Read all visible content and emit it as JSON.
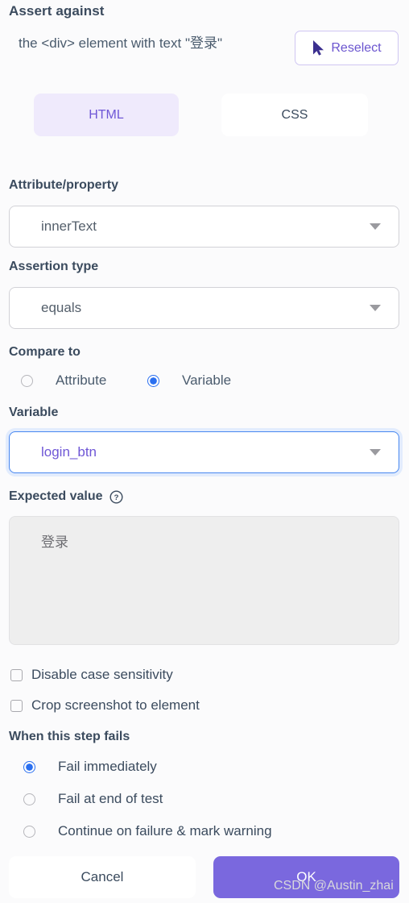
{
  "header": {
    "title": "Assert against",
    "description": "the <div> element with text \"登录\"",
    "reselect_label": "Reselect",
    "cursor_icon": "cursor-arrow-icon"
  },
  "tabs": [
    {
      "label": "HTML",
      "active": true
    },
    {
      "label": "CSS",
      "active": false
    }
  ],
  "fields": {
    "attribute": {
      "label": "Attribute/property",
      "value": "innerText",
      "chevron_icon": "chevron-down-icon"
    },
    "assertion_type": {
      "label": "Assertion type",
      "value": "equals",
      "chevron_icon": "chevron-down-icon"
    },
    "compare_to": {
      "label": "Compare to",
      "options": [
        {
          "label": "Attribute",
          "selected": false
        },
        {
          "label": "Variable",
          "selected": true
        }
      ]
    },
    "variable": {
      "label": "Variable",
      "value": "login_btn",
      "focused": true,
      "chevron_icon": "chevron-down-icon"
    },
    "expected_value": {
      "label": "Expected value",
      "help_icon": "help-circle-icon",
      "value": "登录"
    }
  },
  "checkboxes": [
    {
      "label": "Disable case sensitivity",
      "checked": false
    },
    {
      "label": "Crop screenshot to element",
      "checked": false
    }
  ],
  "failure": {
    "label": "When this step fails",
    "options": [
      {
        "label": "Fail immediately",
        "selected": true
      },
      {
        "label": "Fail at end of test",
        "selected": false
      },
      {
        "label": "Continue on failure & mark warning",
        "selected": false
      }
    ]
  },
  "footer": {
    "cancel_label": "Cancel",
    "ok_label": "OK"
  },
  "watermark": "CSDN @Austin_zhai",
  "colors": {
    "accent_purple": "#7a68de",
    "tab_active_bg": "#efeafc",
    "tab_active_text": "#6f57d6",
    "focus_blue": "#4787f0",
    "radio_blue": "#2a6ff0",
    "heading": "#3b4b5e",
    "page_bg": "#fbfbfc"
  }
}
